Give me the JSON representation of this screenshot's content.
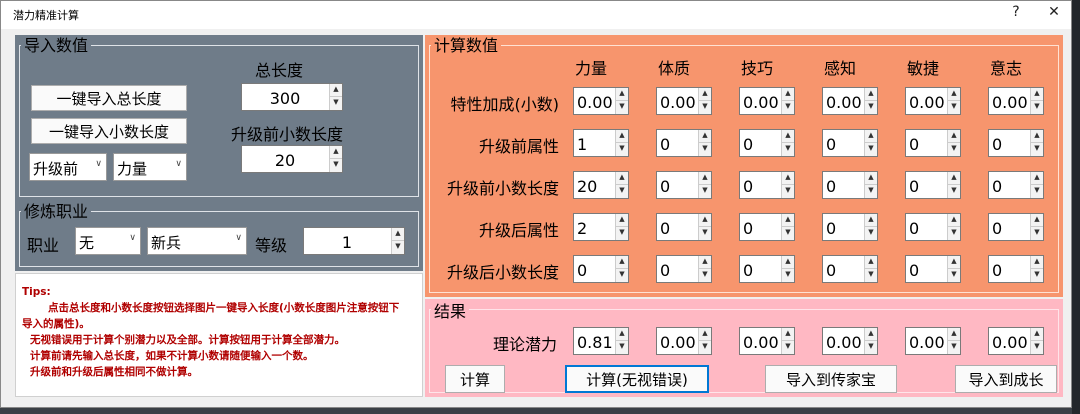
{
  "window": {
    "title": "潜力精准计算",
    "help": "?",
    "close": "✕"
  },
  "import": {
    "group_label": "导入数值",
    "import_total_button": "一键导入总长度",
    "import_decimal_button": "一键导入小数长度",
    "total_length_label": "总长度",
    "total_length_value": "300",
    "pre_decimal_label": "升级前小数长度",
    "pre_decimal_value": "20",
    "stage_select": "升级前",
    "attr_select": "力量"
  },
  "profession": {
    "group_label": "修炼职业",
    "label": "职业",
    "job_select": "无",
    "rank_select": "新兵",
    "level_label": "等级",
    "level_value": "1"
  },
  "tips": {
    "title": "Tips:",
    "lines": [
      "点击总长度和小数长度按钮选择图片一键导入长度(小数长度图片注意按钮下",
      "导入的属性)。",
      "无视错误用于计算个别潜力以及全部。计算按钮用于计算全部潜力。",
      "计算前请先输入总长度，如果不计算小数请随便输入一个数。",
      "升级前和升级后属性相同不做计算。"
    ]
  },
  "calc": {
    "group_label": "计算数值",
    "columns": [
      "力量",
      "体质",
      "技巧",
      "感知",
      "敏捷",
      "意志"
    ],
    "rows": [
      {
        "label": "特性加成(小数)",
        "values": [
          "0.00",
          "0.00",
          "0.00",
          "0.00",
          "0.00",
          "0.00"
        ]
      },
      {
        "label": "升级前属性",
        "values": [
          "1",
          "0",
          "0",
          "0",
          "0",
          "0"
        ]
      },
      {
        "label": "升级前小数长度",
        "values": [
          "20",
          "0",
          "0",
          "0",
          "0",
          "0"
        ]
      },
      {
        "label": "升级后属性",
        "values": [
          "2",
          "0",
          "0",
          "0",
          "0",
          "0"
        ]
      },
      {
        "label": "升级后小数长度",
        "values": [
          "0",
          "0",
          "0",
          "0",
          "0",
          "0"
        ]
      }
    ]
  },
  "result": {
    "group_label": "结果",
    "row_label": "理论潜力",
    "values": [
      "0.81",
      "0.00",
      "0.00",
      "0.00",
      "0.00",
      "0.00"
    ],
    "calc_button": "计算",
    "calc_ignore_button": "计算(无视错误)",
    "export_heirloom_button": "导入到传家宝",
    "export_growth_button": "导入到成长"
  },
  "colors": {
    "left_panel": "#6f7c89",
    "calc_panel": "#f7956d",
    "result_panel": "#ffb8c3",
    "tips_bg": "#ffffff"
  }
}
